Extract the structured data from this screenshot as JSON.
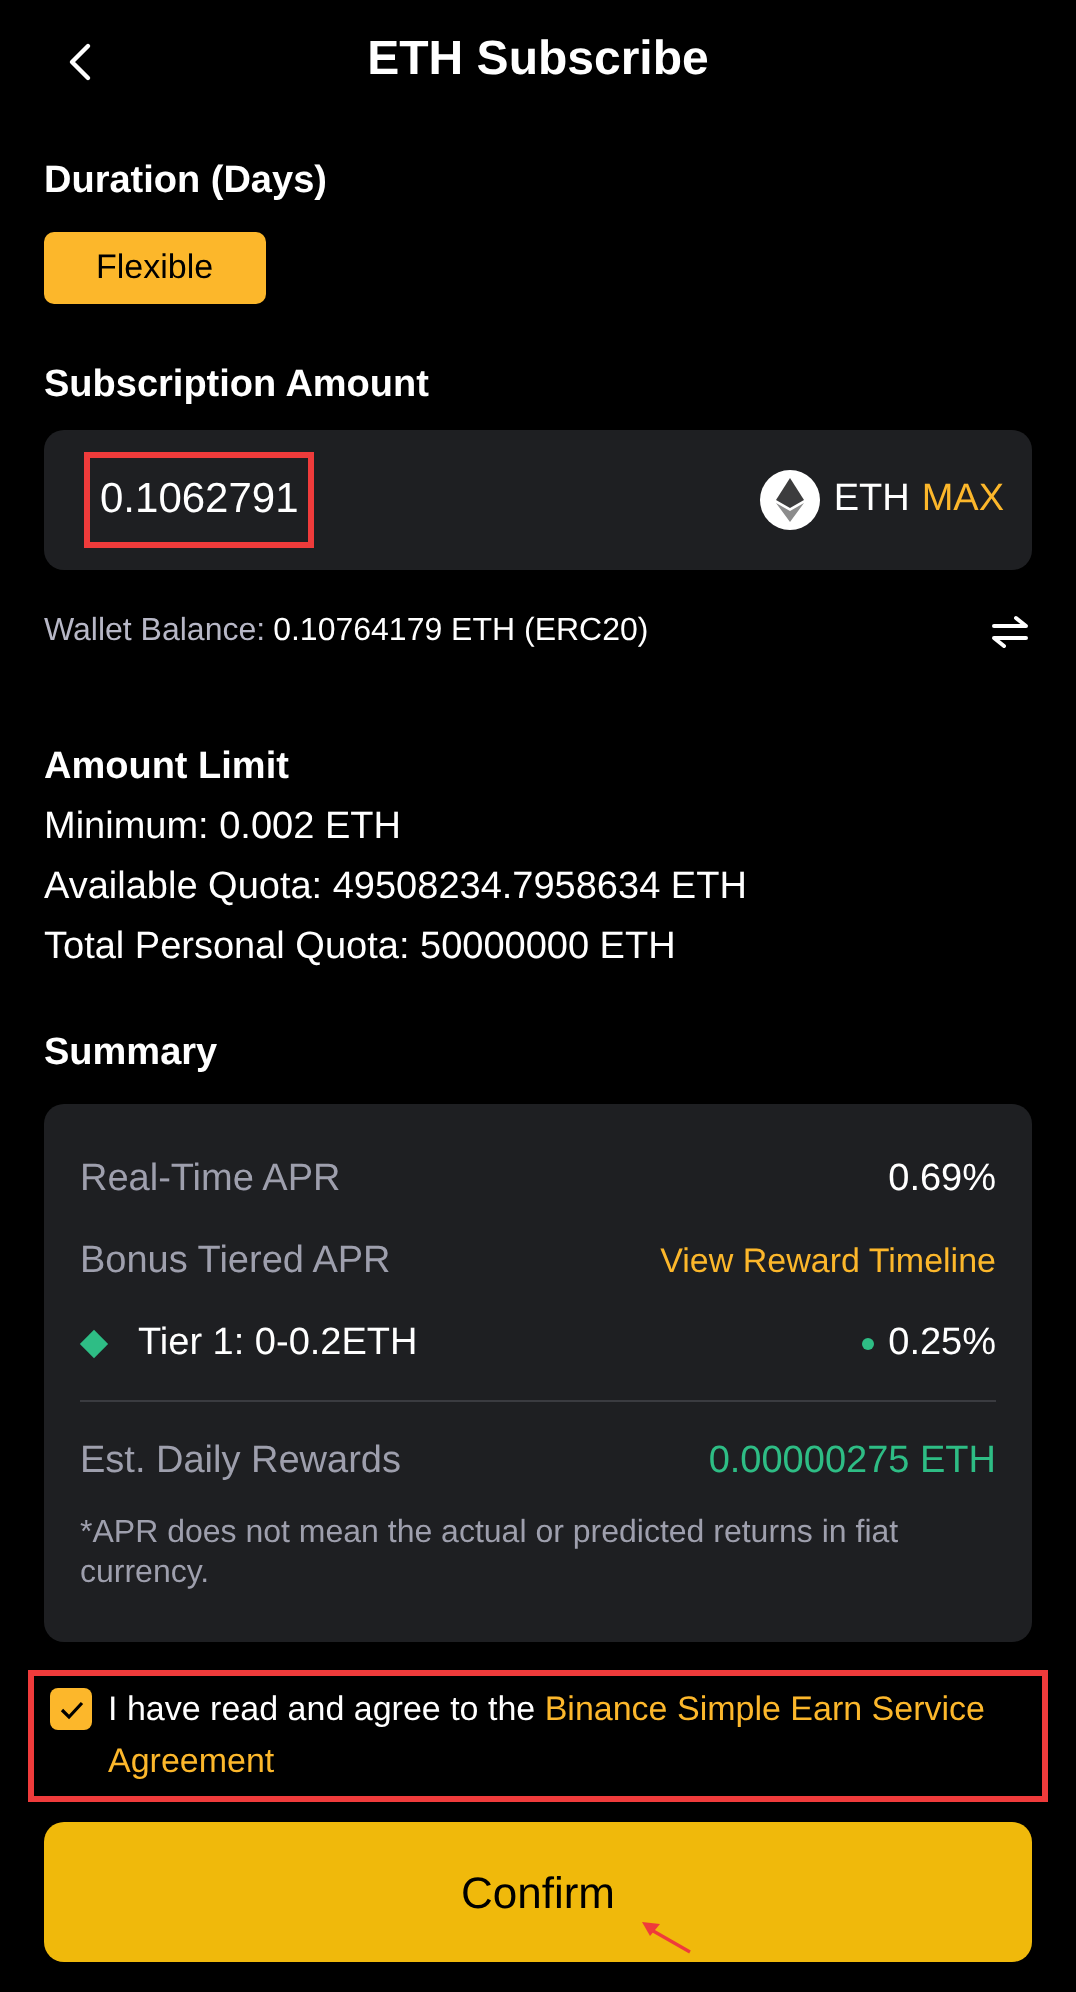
{
  "header": {
    "title": "ETH Subscribe"
  },
  "duration": {
    "label": "Duration (Days)",
    "options": [
      {
        "label": "Flexible",
        "selected": true
      }
    ]
  },
  "amount": {
    "label": "Subscription Amount",
    "value": "0.1062791",
    "highlighted": true,
    "asset": "ETH",
    "max": "MAX"
  },
  "wallet": {
    "label": "Wallet Balance:",
    "value": "0.10764179 ETH (ERC20)"
  },
  "limits": {
    "title": "Amount Limit",
    "lines": [
      "Minimum: 0.002 ETH",
      "Available Quota: 49508234.7958634 ETH",
      "Total Personal Quota: 50000000 ETH"
    ]
  },
  "summary": {
    "title": "Summary",
    "rows": [
      {
        "kind": "plain",
        "label": "Real-Time APR",
        "value": "0.69%"
      },
      {
        "kind": "link",
        "label": "Bonus Tiered APR",
        "value": "View Reward Timeline"
      },
      {
        "kind": "tier",
        "label": "Tier 1: 0-0.2ETH",
        "value": "0.25%",
        "color": "#2ebd85"
      },
      {
        "kind": "reward",
        "label": "Est. Daily Rewards",
        "value": "0.00000275 ETH"
      }
    ],
    "note": "*APR does not mean the actual or predicted returns in fiat currency."
  },
  "agreement": {
    "checked": true,
    "highlighted": true,
    "text": "I have read and agree to the",
    "link": "Binance Simple Earn Service Agreement"
  },
  "confirm": {
    "label": "Confirm",
    "pointed": true
  }
}
